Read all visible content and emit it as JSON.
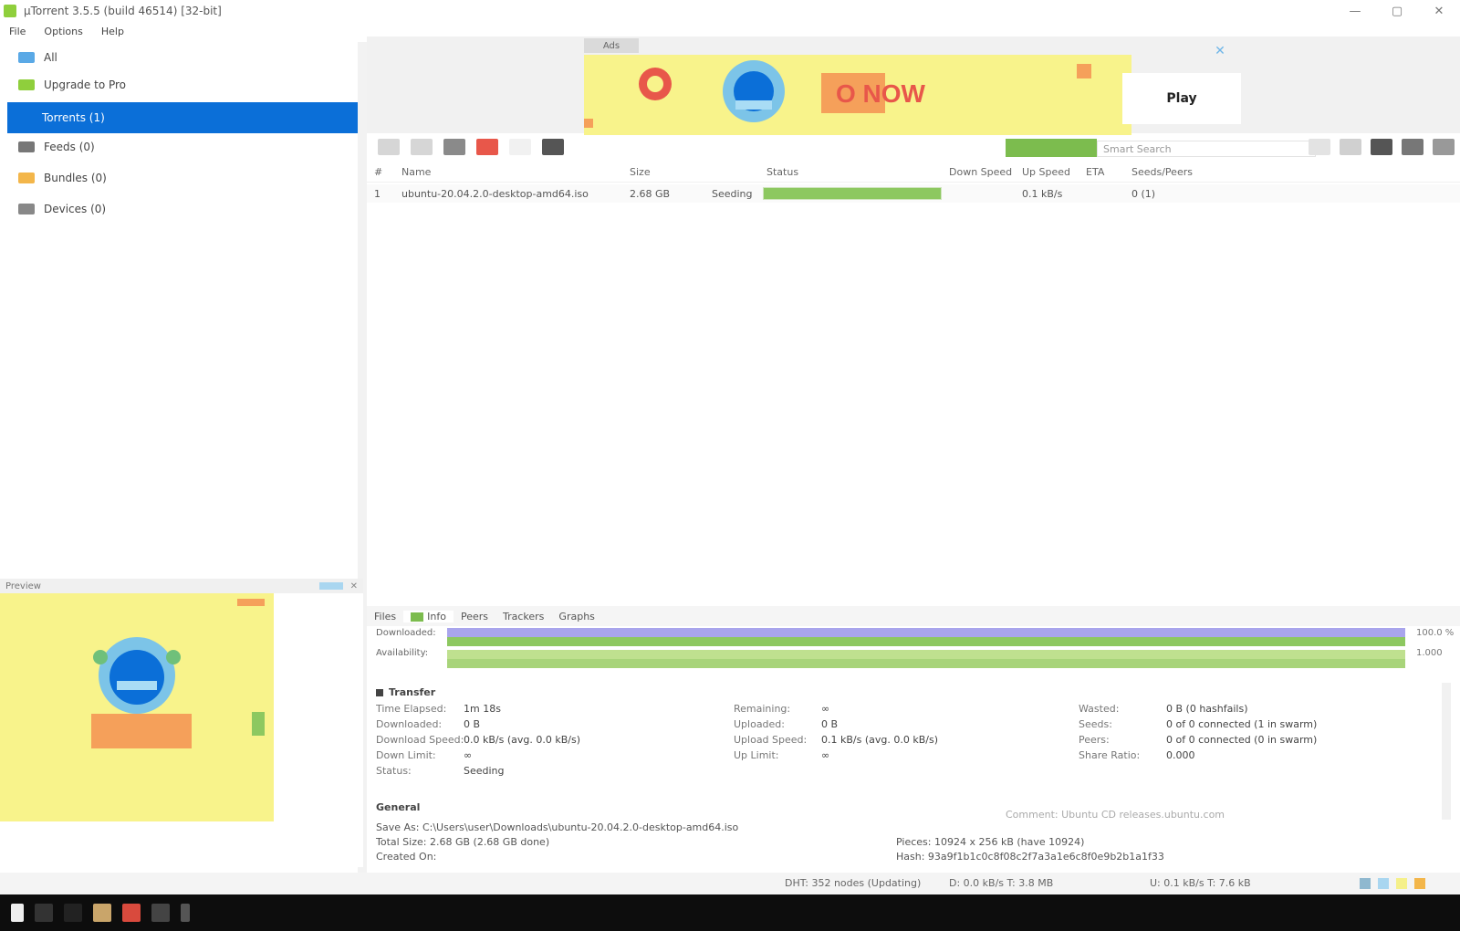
{
  "window": {
    "title": "µTorrent 3.5.5 (build 46514) [32-bit]",
    "controls": {
      "minimize": "—",
      "maximize": "▢",
      "close": "✕"
    }
  },
  "menu": [
    "File",
    "Options",
    "Help"
  ],
  "sidebar": {
    "items": [
      {
        "label": "All",
        "sub": "",
        "color": "#5aa9e6"
      },
      {
        "label": "Upgrade to Pro",
        "sub": "",
        "color": "#8fcf3c"
      },
      {
        "label": "Torrents (1)",
        "sub": "",
        "color": "#ffffff",
        "active": true
      },
      {
        "label": "Feeds (0)",
        "sub": "",
        "color": "#777777"
      },
      {
        "label": "Bundles (0)",
        "sub": "",
        "color": "#f3b64a"
      },
      {
        "label": "Devices (0)",
        "sub": "",
        "color": "#888888"
      }
    ]
  },
  "preview": {
    "title": "Preview",
    "close": "✕"
  },
  "banner": {
    "label": "Ads",
    "text": "O  NOW",
    "cta": "Play",
    "close": "✕",
    "colors": {
      "bg": "#f8f38b",
      "accent": "#0b6fd8"
    }
  },
  "toolbar": {
    "buttons": [
      "add-torrent",
      "add-url",
      "create",
      "remove",
      "start",
      "stop"
    ],
    "search_placeholder": "Smart Search",
    "right_buttons": [
      "rss",
      "remote",
      "settings",
      "list-view",
      "detail-view"
    ]
  },
  "table": {
    "headers": [
      "#",
      "Name",
      "Size",
      "Status",
      "Down Speed",
      "Up Speed",
      "ETA",
      "Seeds/Peers"
    ],
    "rows": [
      {
        "index": "1",
        "name": "ubuntu-20.04.2.0-desktop-amd64.iso",
        "size": "2.68 GB",
        "status": "Seeding",
        "progress": 100,
        "down": "",
        "up": "0.1 kB/s",
        "eta": "",
        "seeds": "0 (1)"
      }
    ]
  },
  "details": {
    "tabs": [
      "Files",
      "Info",
      "Peers",
      "Trackers",
      "Graphs"
    ],
    "active_tab": "Info",
    "bars": [
      {
        "label": "Downloaded:",
        "end": "100.0 %",
        "color": "#a9a5ec"
      },
      {
        "label": "Availability:",
        "end": "1.000",
        "color": "#8dc860"
      }
    ],
    "transfer_title": "Transfer",
    "col1": [
      {
        "k": "Time Elapsed:",
        "v": "1m 18s"
      },
      {
        "k": "Downloaded:",
        "v": "0 B"
      },
      {
        "k": "Download Speed:",
        "v": "0.0 kB/s (avg. 0.0 kB/s)"
      },
      {
        "k": "Down Limit:",
        "v": "∞"
      },
      {
        "k": "Status:",
        "v": "Seeding"
      }
    ],
    "col2": [
      {
        "k": "Remaining:",
        "v": "∞"
      },
      {
        "k": "Uploaded:",
        "v": "0 B"
      },
      {
        "k": "Upload Speed:",
        "v": "0.1 kB/s (avg. 0.0 kB/s)"
      },
      {
        "k": "Up Limit:",
        "v": "∞"
      }
    ],
    "col3": [
      {
        "k": "Wasted:",
        "v": "0 B (0 hashfails)"
      },
      {
        "k": "Seeds:",
        "v": "0 of 0 connected (1 in swarm)"
      },
      {
        "k": "Peers:",
        "v": "0 of 0 connected (0 in swarm)"
      },
      {
        "k": "Share Ratio:",
        "v": "0.000"
      }
    ],
    "general_title": "General",
    "general": {
      "save_as": "Save As: C:\\Users\\user\\Downloads\\ubuntu-20.04.2.0-desktop-amd64.iso",
      "total_size": "Total Size:   2.68 GB (2.68 GB done)",
      "created_on": "Created On:",
      "pieces": "Pieces: 10924 x 256 kB (have 10924)",
      "hash": "Hash: 93a9f1b1c0c8f08c2f7a3a1e6c8f0e9b2b1a1f33",
      "comment": "Comment: Ubuntu CD releases.ubuntu.com"
    }
  },
  "status": {
    "dht": "DHT: 352 nodes (Updating)",
    "down": "D: 0.0 kB/s T: 3.8 MB",
    "up": "U: 0.1 kB/s T: 7.6 kB"
  }
}
